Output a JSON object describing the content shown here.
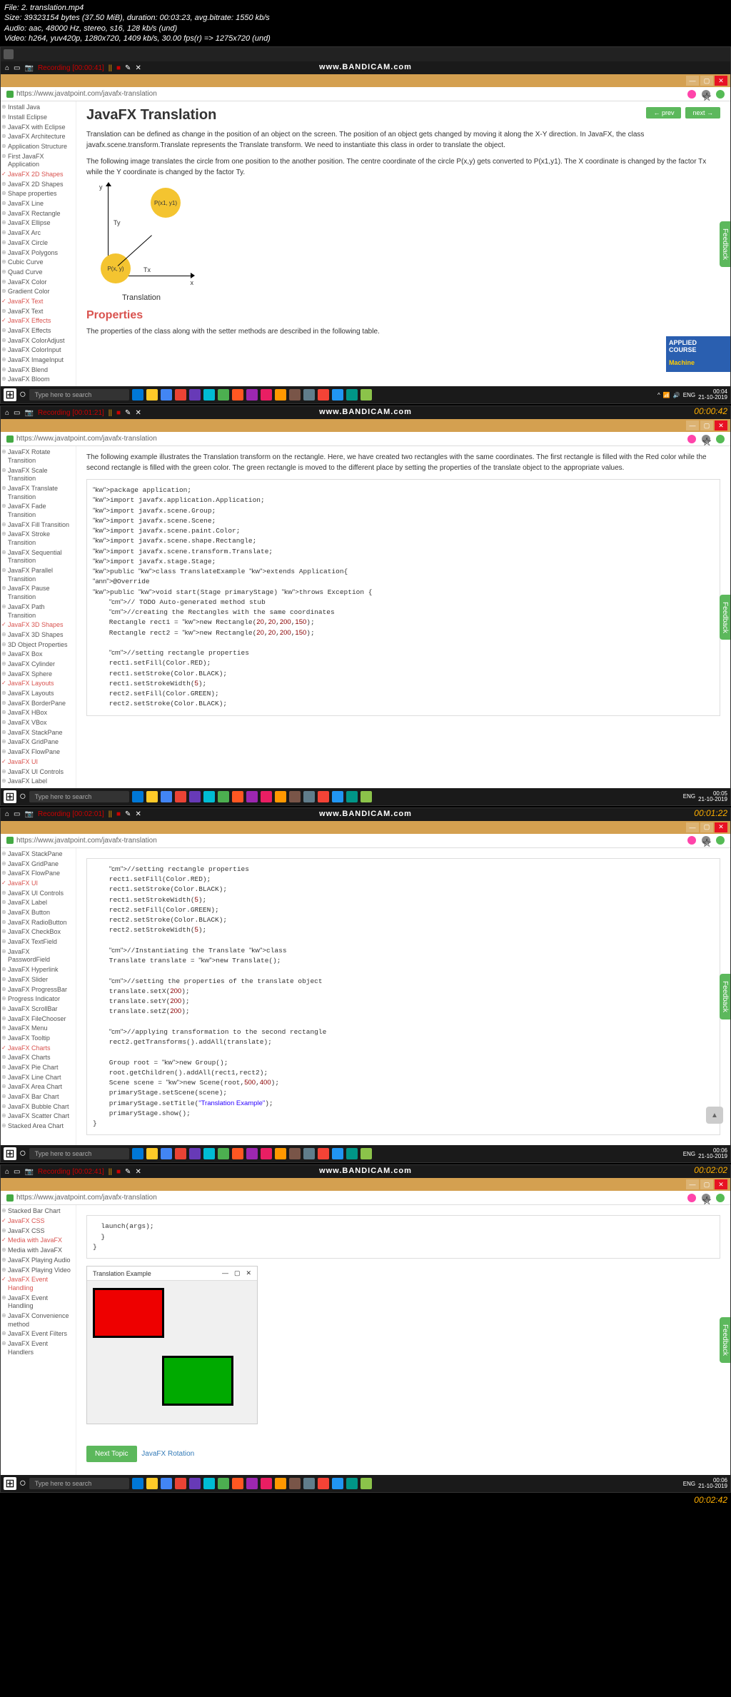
{
  "file_info": {
    "l1": "File: 2. translation.mp4",
    "l2": "Size: 39323154 bytes (37.50 MiB), duration: 00:03:23, avg.bitrate: 1550 kb/s",
    "l3": "Audio: aac, 48000 Hz, stereo, s16, 128 kb/s (und)",
    "l4": "Video: h264, yuv420p, 1280x720, 1409 kb/s, 30.00 fps(r) => 1275x720 (und)"
  },
  "bandicam": "www.BANDICAM.com",
  "url": "https://www.javatpoint.com/javafx-translation",
  "frame1": {
    "rec": "Recording [00:00:41]",
    "sidebar": [
      "Install Java",
      "Install Eclipse",
      "JavaFX with Eclipse",
      "JavaFX Architecture",
      "Application Structure",
      "First JavaFX Application",
      "JavaFX 2D Shapes",
      "JavaFX 2D Shapes",
      "Shape properties",
      "JavaFX Line",
      "JavaFX Rectangle",
      "JavaFX Ellipse",
      "JavaFX Arc",
      "JavaFX Circle",
      "JavaFX Polygons",
      "Cubic Curve",
      "Quad Curve",
      "JavaFX Color",
      "Gradient Color",
      "JavaFX Text",
      "JavaFX Text",
      "JavaFX Effects",
      "JavaFX Effects",
      "JavaFX ColorAdjust",
      "JavaFX ColorInput",
      "JavaFX ImageInput",
      "JavaFX Blend",
      "JavaFX Bloom"
    ],
    "checked": [
      6,
      19,
      21
    ],
    "h1": "JavaFX Translation",
    "p1": "Translation can be defined as change in the position of an object on the screen. The position of an object gets changed by moving it along the X-Y direction. In JavaFX, the class javafx.scene.transform.Translate represents the Translate transform. We need to instantiate this class in order to translate the object.",
    "p2": "The following image translates the circle from one position to the another position. The centre coordinate of the circle P(x,y) gets converted to P(x1,y1). The X coordinate is changed by the factor Tx while the Y coordinate is changed by the factor Ty.",
    "diag": {
      "p1": "P(x, y)",
      "p2": "P(x1, y1)",
      "tx": "Tx",
      "ty": "Ty",
      "x": "x",
      "y": "y",
      "caption": "Translation"
    },
    "h2": "Properties",
    "p3": "The properties of the class along with the setter methods are described in the following table.",
    "prev": "← prev",
    "next": "next →",
    "ad": {
      "l1": "APPLIED",
      "l2": "COURSE",
      "l3": "Machine"
    },
    "feedback": "Feedback",
    "search": "Type here to search",
    "tray_time": "00:04",
    "tray_date": "21-10-2019",
    "ts": "00:00:42"
  },
  "frame2": {
    "rec": "Recording [00:01:21]",
    "sidebar": [
      "JavaFX Rotate Transition",
      "JavaFX Scale Transition",
      "JavaFX Translate Transition",
      "JavaFX Fade Transition",
      "JavaFX Fill Transition",
      "JavaFX Stroke Transition",
      "JavaFX Sequential Transition",
      "JavaFX Parallel Transition",
      "JavaFX Pause Transition",
      "JavaFX Path Transition",
      "JavaFX 3D Shapes",
      "JavaFX 3D Shapes",
      "3D Object Properties",
      "JavaFX Box",
      "JavaFX Cylinder",
      "JavaFX Sphere",
      "JavaFX Layouts",
      "JavaFX Layouts",
      "JavaFX BorderPane",
      "JavaFX HBox",
      "JavaFX VBox",
      "JavaFX StackPane",
      "JavaFX GridPane",
      "JavaFX FlowPane",
      "JavaFX UI",
      "JavaFX UI Controls",
      "JavaFX Label"
    ],
    "checked": [
      10,
      16,
      24
    ],
    "p1": "The following example illustrates the Translation transform on the rectangle. Here, we have created two rectangles with the same coordinates. The first rectangle is filled with the Red color while the second rectangle is filled with the green color. The green rectangle is moved to the different place by setting the properties of the translate object to the appropriate values.",
    "feedback": "Feedback",
    "search": "Type here to search",
    "tray_time": "00:05",
    "tray_date": "21-10-2019",
    "ts": "00:01:22"
  },
  "frame3": {
    "rec": "Recording [00:02:01]",
    "sidebar": [
      "JavaFX StackPane",
      "JavaFX GridPane",
      "JavaFX FlowPane",
      "JavaFX UI",
      "JavaFX UI Controls",
      "JavaFX Label",
      "JavaFX Button",
      "JavaFX RadioButton",
      "JavaFX CheckBox",
      "JavaFX TextField",
      "JavaFX PasswordField",
      "JavaFX Hyperlink",
      "JavaFX Slider",
      "JavaFX ProgressBar",
      "Progress Indicator",
      "JavaFX ScrollBar",
      "JavaFX FileChooser",
      "JavaFX Menu",
      "JavaFX Tooltip",
      "JavaFX Charts",
      "JavaFX Charts",
      "JavaFX Pie Chart",
      "JavaFX Line Chart",
      "JavaFX Area Chart",
      "JavaFX Bar Chart",
      "JavaFX Bubble Chart",
      "JavaFX Scatter Chart",
      "Stacked Area Chart"
    ],
    "checked": [
      3,
      19
    ],
    "feedback": "Feedback",
    "search": "Type here to search",
    "tray_time": "00:06",
    "tray_date": "21-10-2019",
    "ts": "00:02:02"
  },
  "frame4": {
    "rec": "Recording [00:02:41]",
    "sidebar": [
      "Stacked Bar Chart",
      "JavaFX CSS",
      "JavaFX CSS",
      "Media with JavaFX",
      "Media with JavaFX",
      "JavaFX Playing Audio",
      "JavaFX Playing Video",
      "JavaFX Event Handling",
      "JavaFX Event Handling",
      "JavaFX Convenience method",
      "JavaFX Event Filters",
      "JavaFX Event Handlers"
    ],
    "checked": [
      1,
      3,
      7
    ],
    "code_tail": "  launch(args);\n  }\n}",
    "win_title": "Translation Example",
    "next_topic": "Next Topic",
    "next_link": "JavaFX Rotation",
    "feedback": "Feedback",
    "search": "Type here to search",
    "tray_time": "00:06",
    "tray_date": "21-10-2019",
    "ts": "00:02:42"
  },
  "code2": "package application;\nimport javafx.application.Application;\nimport javafx.scene.Group;\nimport javafx.scene.Scene;\nimport javafx.scene.paint.Color;\nimport javafx.scene.shape.Rectangle;\nimport javafx.scene.transform.Translate;\nimport javafx.stage.Stage;\npublic class TranslateExample extends Application{\n@Override\npublic void start(Stage primaryStage) throws Exception {\n    // TODO Auto-generated method stub\n    //creating the Rectangles with the same coordinates\n    Rectangle rect1 = new Rectangle(20,20,200,150);\n    Rectangle rect2 = new Rectangle(20,20,200,150);\n\n    //setting rectangle properties\n    rect1.setFill(Color.RED);\n    rect1.setStroke(Color.BLACK);\n    rect1.setStrokeWidth(5);\n    rect2.setFill(Color.GREEN);\n    rect2.setStroke(Color.BLACK);",
  "code3": "    //setting rectangle properties\n    rect1.setFill(Color.RED);\n    rect1.setStroke(Color.BLACK);\n    rect1.setStrokeWidth(5);\n    rect2.setFill(Color.GREEN);\n    rect2.setStroke(Color.BLACK);\n    rect2.setStrokeWidth(5);\n\n    //Instantiating the Translate class\n    Translate translate = new Translate();\n\n    //setting the properties of the translate object\n    translate.setX(200);\n    translate.setY(200);\n    translate.setZ(200);\n\n    //applying transformation to the second rectangle\n    rect2.getTransforms().addAll(translate);\n\n    Group root = new Group();\n    root.getChildren().addAll(rect1,rect2);\n    Scene scene = new Scene(root,500,400);\n    primaryStage.setScene(scene);\n    primaryStage.setTitle(\"Translation Example\");\n    primaryStage.show();\n}",
  "taskbar_colors": [
    "#0078d7",
    "#ffca28",
    "#4285f4",
    "#ea4335",
    "#673ab7",
    "#00bcd4",
    "#4caf50",
    "#ff5722",
    "#9c27b0",
    "#e91e63",
    "#ff9800",
    "#795548",
    "#607d8b",
    "#f44336",
    "#2196f3",
    "#009688",
    "#8bc34a"
  ]
}
